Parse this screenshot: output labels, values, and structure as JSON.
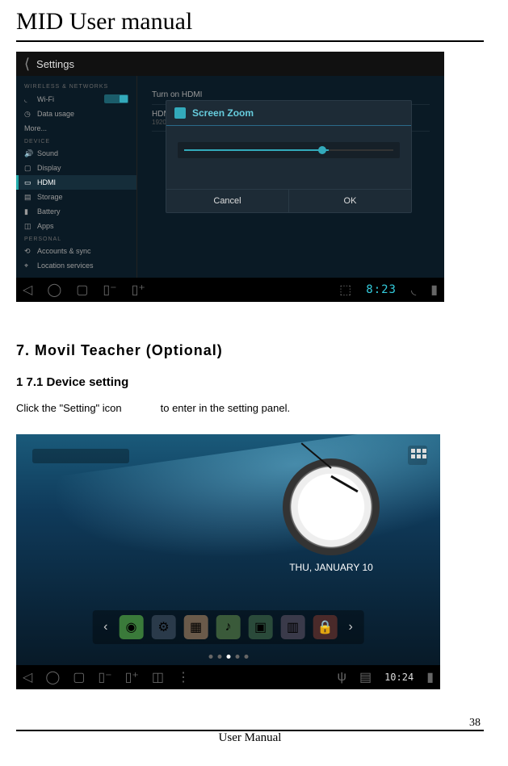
{
  "doc": {
    "title": "MID User manual",
    "section_heading": "7. Movil Teacher (Optional)",
    "subsection_heading": "1 7.1 Device setting",
    "body_prefix": "Click the \"Setting\" icon",
    "body_suffix": "to enter in the setting panel.",
    "page_number": "38",
    "footer_label": "User Manual"
  },
  "shot1": {
    "topbar_title": "Settings",
    "sections": {
      "wireless": "WIRELESS & NETWORKS",
      "device": "DEVICE",
      "personal": "PERSONAL"
    },
    "items": {
      "wifi": "Wi-Fi",
      "wifi_toggle": "ON",
      "data_usage": "Data usage",
      "more": "More...",
      "sound": "Sound",
      "display": "Display",
      "hdmi": "HDMI",
      "storage": "Storage",
      "battery": "Battery",
      "apps": "Apps",
      "accounts": "Accounts & sync",
      "location": "Location services"
    },
    "content": {
      "turn_on": "Turn on HDMI",
      "resolution": "HDMI Resolution",
      "resolution_sub": "1920x1080p-60Hz"
    },
    "dialog": {
      "title": "Screen Zoom",
      "cancel": "Cancel",
      "ok": "OK"
    },
    "clock": "8:23"
  },
  "shot2": {
    "date": "THU, JANUARY 10",
    "clock": "10:24",
    "apps": [
      {
        "name": "browser",
        "bg": "#3a7a3a",
        "glyph": "◉"
      },
      {
        "name": "settings",
        "bg": "#2a3a4a",
        "glyph": "⚙"
      },
      {
        "name": "gallery",
        "bg": "#6a5a4a",
        "glyph": "▦"
      },
      {
        "name": "music",
        "bg": "#3a5a3a",
        "glyph": "♪"
      },
      {
        "name": "market",
        "bg": "#2a4a3a",
        "glyph": "▣"
      },
      {
        "name": "calendar",
        "bg": "#3a3a4a",
        "glyph": "▥"
      },
      {
        "name": "lock",
        "bg": "#4a2a2a",
        "glyph": "🔒"
      }
    ]
  }
}
